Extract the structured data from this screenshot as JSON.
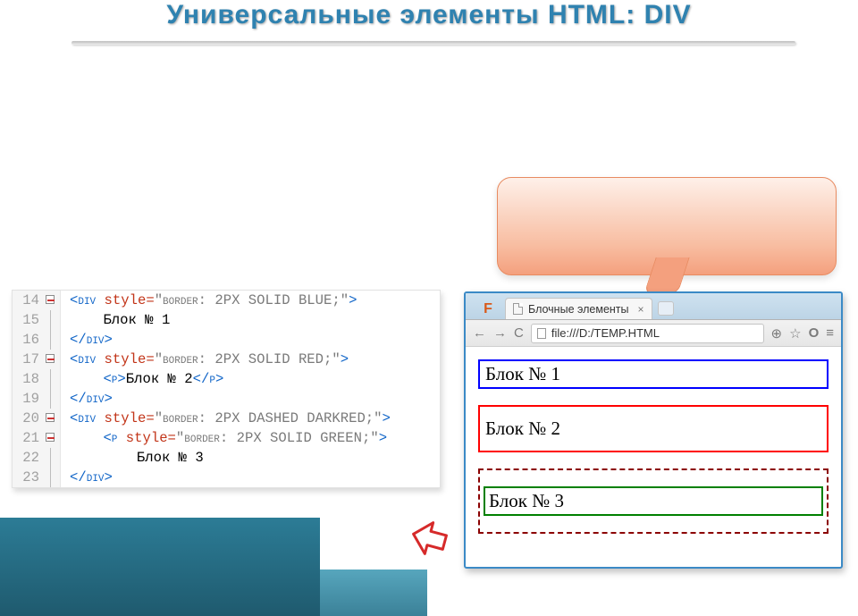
{
  "title": "Универсальные элементы HTML: DIV",
  "code": {
    "lines": [
      "14",
      "15",
      "16",
      "17",
      "18",
      "19",
      "20",
      "21",
      "22",
      "23"
    ],
    "l14_open": "<div ",
    "l14_attr": "style=",
    "l14_str": "\"border: 2PX SOLID BLUE;\"",
    "l14_close": ">",
    "l15_txt": "Блок № 1",
    "l16": "</div>",
    "l17_open": "<div ",
    "l17_attr": "style=",
    "l17_str": "\"border: 2PX SOLID RED;\"",
    "l17_close": ">",
    "l18_po": "<p>",
    "l18_txt": "Блок № 2",
    "l18_pc": "</p>",
    "l19": "</div>",
    "l20_open": "<div ",
    "l20_attr": "style=",
    "l20_str": "\"border: 2PX DASHED DARKRED;\"",
    "l20_close": ">",
    "l21_open": "<p ",
    "l21_attr": "style=",
    "l21_str": "\"border: 2PX SOLID GREEN;\"",
    "l21_close": ">",
    "l22_txt": "Блок № 3",
    "l23": "</div>"
  },
  "browser": {
    "tab_title": "Блочные элементы",
    "tab_close": "×",
    "logo": "F",
    "back": "←",
    "fwd": "→",
    "reload": "C",
    "url": "file:///D:/TEMP.HTML",
    "zoom": "⊕",
    "star": "☆",
    "opera": "O",
    "menu": "≡",
    "block1": "Блок № 1",
    "block2": "Блок № 2",
    "block3": "Блок № 3"
  }
}
